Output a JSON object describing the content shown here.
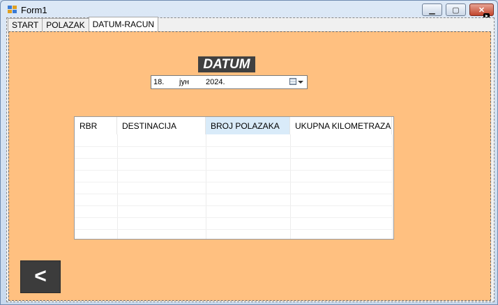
{
  "window": {
    "title": "Form1"
  },
  "tabs": [
    {
      "label": "START"
    },
    {
      "label": "POLAZAK"
    },
    {
      "label": "DATUM-RACUN",
      "active": true
    }
  ],
  "datum": {
    "label": "DATUM",
    "date_day": "18.",
    "date_month": "јун",
    "date_year": "2024."
  },
  "grid": {
    "columns": [
      "RBR",
      "DESTINACIJA",
      "BROJ POLAZAKA",
      "UKUPNA KILOMETRAZA"
    ],
    "selected_column": "BROJ POLAZAKA",
    "rows": []
  },
  "back_button": {
    "label": "<"
  },
  "colors": {
    "page_bg": "#ffc080",
    "label_bg": "#404040",
    "button_bg": "#3c3c3c",
    "selected_header": "#d9ebf9"
  }
}
